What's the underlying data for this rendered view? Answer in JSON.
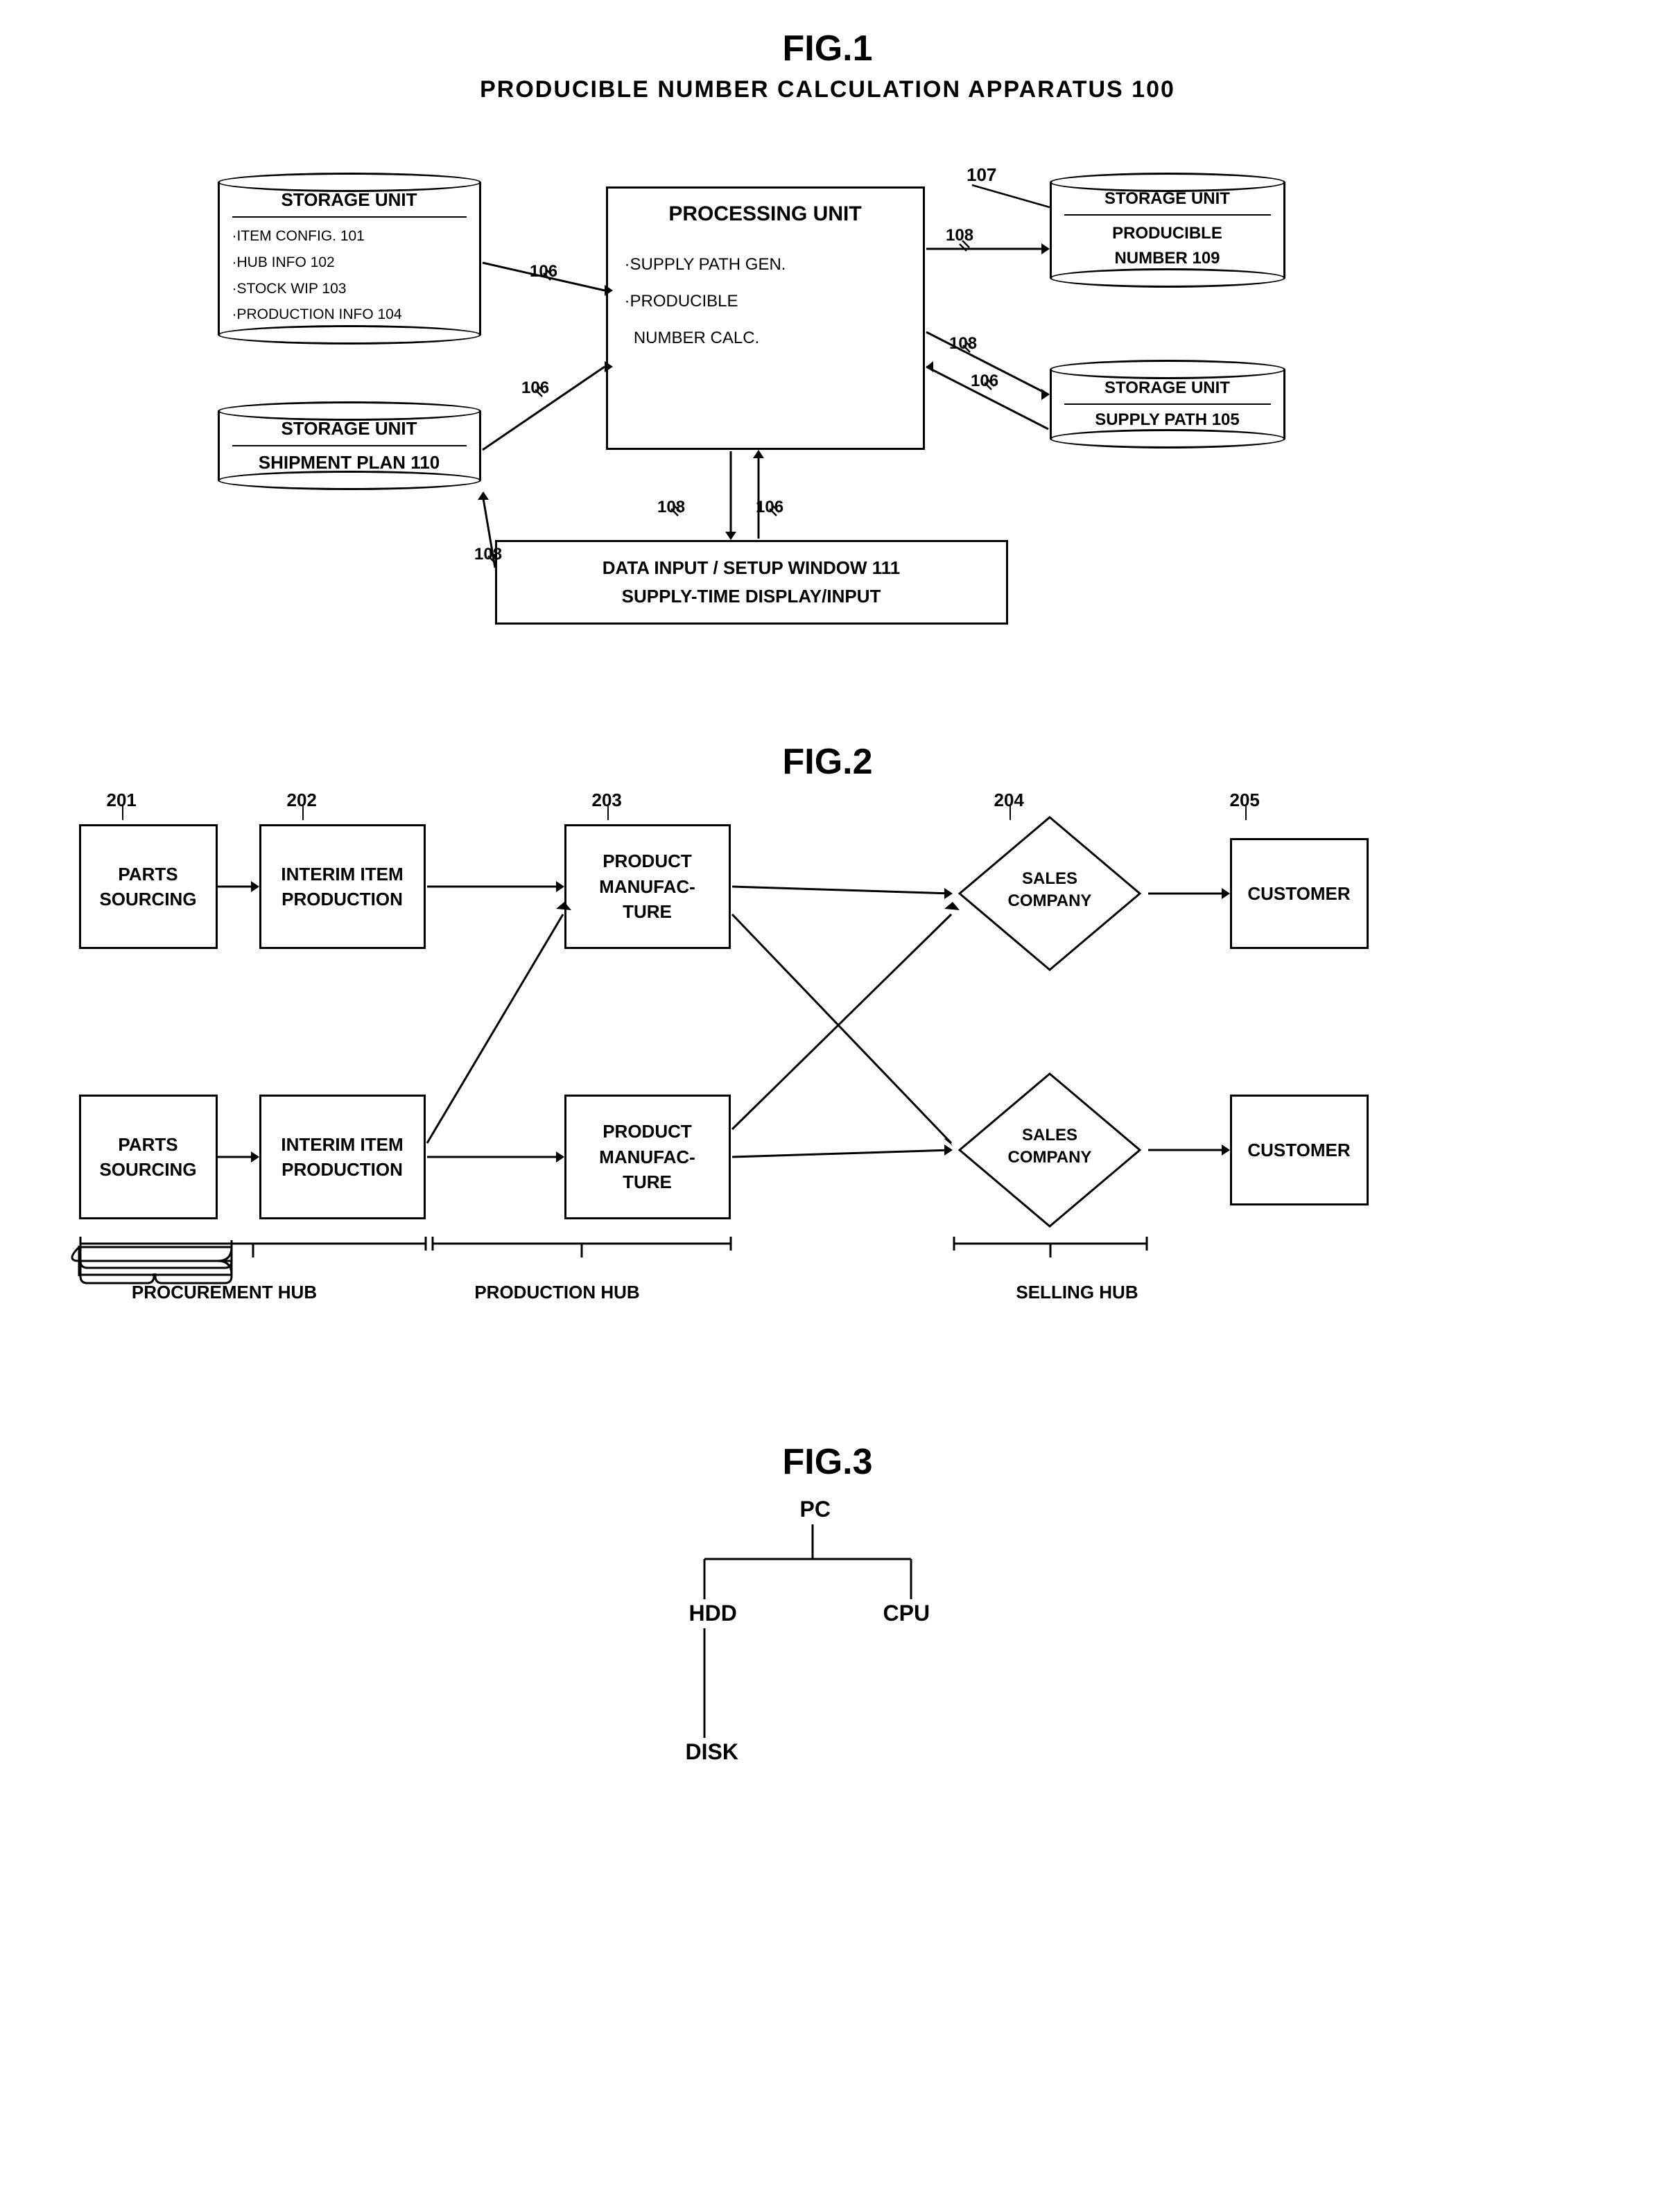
{
  "fig1": {
    "title": "FIG.1",
    "subtitle": "PRODUCIBLE NUMBER CALCULATION APPARATUS 100",
    "storage_unit_label": "STORAGE UNIT",
    "storage_unit_items": [
      "·ITEM CONFIG. 101",
      "·HUB INFO 102",
      "·STOCK WIP 103",
      "·PRODUCTION INFO 104"
    ],
    "storage_unit2_label": "STORAGE UNIT",
    "storage_unit2_item": "SHIPMENT PLAN 110",
    "processing_unit_label": "PROCESSING UNIT",
    "processing_unit_items": [
      "·SUPPLY PATH GEN.",
      "·PRODUCIBLE",
      "  NUMBER CALC."
    ],
    "storage_unit3_label": "STORAGE UNIT",
    "storage_unit3_item": "PRODUCIBLE\nNUMBER 109",
    "storage_unit4_label": "STORAGE UNIT",
    "storage_unit4_item": "SUPPLY PATH 105",
    "data_input_line1": "DATA INPUT / SETUP WINDOW 111",
    "data_input_line2": "SUPPLY-TIME DISPLAY/INPUT",
    "ref_106_a": "106",
    "ref_106_b": "106",
    "ref_106_c": "106",
    "ref_106_d": "106",
    "ref_107": "107",
    "ref_108_a": "108",
    "ref_108_b": "108",
    "ref_108_c": "108"
  },
  "fig2": {
    "title": "FIG.2",
    "ref_201": "201",
    "ref_202": "202",
    "ref_203": "203",
    "ref_204": "204",
    "ref_205": "205",
    "box_parts1": "PARTS\nSOURCING",
    "box_parts2": "PARTS\nSOURCING",
    "box_interim1": "INTERIM ITEM\nPRODUCTION",
    "box_interim2": "INTERIM ITEM\nPRODUCTION",
    "box_product1": "PRODUCT\nMANUFAC-\nTURE",
    "box_product2": "PRODUCT\nMANUFAC-\nTURE",
    "diamond_sales1": "SALES\nCOMPANY",
    "diamond_sales2": "SALES\nCOMPANY",
    "box_customer1": "CUSTOMER",
    "box_customer2": "CUSTOMER",
    "label_procurement": "PROCUREMENT HUB",
    "label_production": "PRODUCTION HUB",
    "label_selling": "SELLING HUB"
  },
  "fig3": {
    "title": "FIG.3",
    "node_pc": "PC",
    "node_hdd": "HDD",
    "node_cpu": "CPU",
    "node_disk": "DISK"
  }
}
